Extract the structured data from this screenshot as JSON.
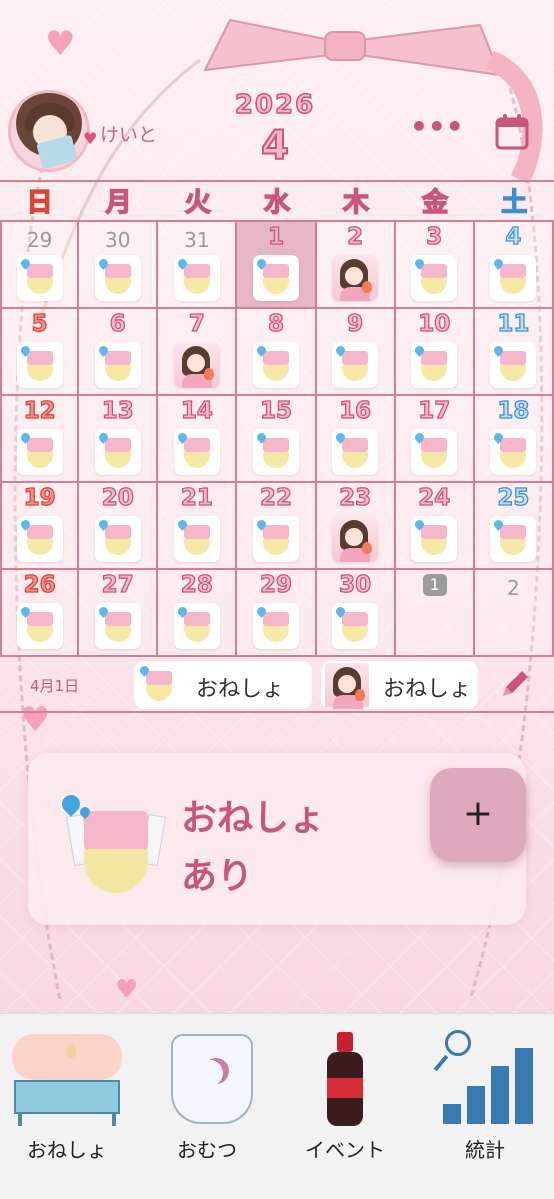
{
  "header": {
    "username": "けいと",
    "year": "2026",
    "month": "4",
    "more_label": "•••"
  },
  "weekdays": [
    "日",
    "月",
    "火",
    "水",
    "木",
    "金",
    "土"
  ],
  "calendar": {
    "days": [
      {
        "label": "29",
        "other": true,
        "icon": "diaper-icon"
      },
      {
        "label": "30",
        "other": true,
        "icon": "diaper-icon"
      },
      {
        "label": "31",
        "other": true,
        "icon": "diaper-icon"
      },
      {
        "label": "1",
        "selected": true,
        "icon": "diaper-icon"
      },
      {
        "label": "2",
        "icon": "girl-icon"
      },
      {
        "label": "3",
        "icon": "diaper-icon"
      },
      {
        "label": "4",
        "icon": "diaper-icon"
      },
      {
        "label": "5",
        "icon": "diaper-icon"
      },
      {
        "label": "6",
        "icon": "diaper-icon"
      },
      {
        "label": "7",
        "icon": "girl-icon"
      },
      {
        "label": "8",
        "icon": "diaper-icon"
      },
      {
        "label": "9",
        "icon": "diaper-icon"
      },
      {
        "label": "10",
        "icon": "diaper-icon"
      },
      {
        "label": "11",
        "icon": "diaper-icon"
      },
      {
        "label": "12",
        "icon": "diaper-icon"
      },
      {
        "label": "13",
        "icon": "diaper-icon"
      },
      {
        "label": "14",
        "icon": "diaper-icon"
      },
      {
        "label": "15",
        "icon": "diaper-icon"
      },
      {
        "label": "16",
        "icon": "diaper-icon"
      },
      {
        "label": "17",
        "icon": "diaper-icon"
      },
      {
        "label": "18",
        "icon": "diaper-icon"
      },
      {
        "label": "19",
        "icon": "diaper-icon"
      },
      {
        "label": "20",
        "icon": "diaper-icon"
      },
      {
        "label": "21",
        "icon": "diaper-icon"
      },
      {
        "label": "22",
        "icon": "diaper-icon"
      },
      {
        "label": "23",
        "icon": "girl-icon"
      },
      {
        "label": "24",
        "icon": "diaper-icon"
      },
      {
        "label": "25",
        "icon": "diaper-icon"
      },
      {
        "label": "26",
        "icon": "diaper-icon"
      },
      {
        "label": "27",
        "icon": "diaper-icon"
      },
      {
        "label": "28",
        "icon": "diaper-icon"
      },
      {
        "label": "29",
        "icon": "diaper-icon"
      },
      {
        "label": "30",
        "icon": "diaper-icon"
      },
      {
        "label": "1",
        "badge": true,
        "icon": null
      },
      {
        "label": "2",
        "other": true,
        "icon": null
      }
    ]
  },
  "event_bar": {
    "date": "4月1日",
    "chips": [
      {
        "label": "おねしょ",
        "icon": "diaper-icon"
      },
      {
        "label": "おねしょ",
        "icon": "girl-icon"
      }
    ]
  },
  "detail": {
    "line1": "おねしょ",
    "line2": "あり",
    "add_label": "+"
  },
  "tabs": [
    {
      "label": "おねしょ",
      "icon": "bed-icon"
    },
    {
      "label": "おむつ",
      "icon": "diaper-icon"
    },
    {
      "label": "イベント",
      "icon": "bottle-icon"
    },
    {
      "label": "統計",
      "icon": "stats-icon"
    }
  ],
  "colors": {
    "accent": "#c9557a",
    "sunday": "#d9453a",
    "saturday": "#3f8fd0",
    "grid": "#d27f95",
    "selected": "#d68ba3"
  }
}
